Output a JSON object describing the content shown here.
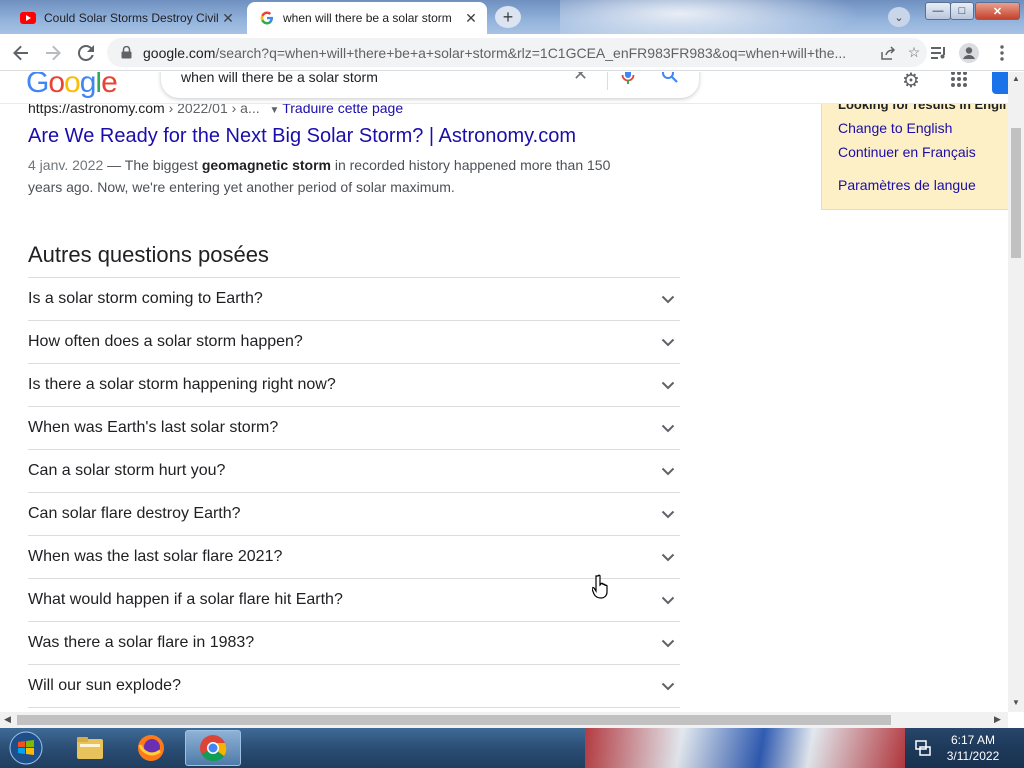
{
  "tabs": [
    {
      "title": "Could Solar Storms Destroy Civili",
      "active": false,
      "icon": "youtube-icon"
    },
    {
      "title": "when will there be a solar storm",
      "active": true,
      "icon": "google-icon"
    }
  ],
  "window_controls": {
    "minimize": "—",
    "maximize": "□",
    "close": "✕"
  },
  "omnibox": {
    "host": "google.com",
    "rest": "/search?q=when+will+there+be+a+solar+storm&rlz=1C1GCEA_enFR983FR983&oq=when+will+the..."
  },
  "search": {
    "logo": "Google",
    "query": "when will there be a solar storm"
  },
  "result": {
    "cite_url": "https://astronomy.com",
    "cite_path": " › 2022/01 › a...",
    "translate_label": "Traduire cette page",
    "title": "Are We Ready for the Next Big Solar Storm? | Astronomy.com",
    "date": "4 janv. 2022",
    "snippet_pre": " — The biggest ",
    "snippet_bold": "geomagnetic storm",
    "snippet_post": " in recorded history happened more than 150 years ago. Now, we're entering yet another period of solar maximum."
  },
  "paa": {
    "title": "Autres questions posées",
    "questions": [
      "Is a solar storm coming to Earth?",
      "How often does a solar storm happen?",
      "Is there a solar storm happening right now?",
      "When was Earth's last solar storm?",
      "Can a solar storm hurt you?",
      "Can solar flare destroy Earth?",
      "When was the last solar flare 2021?",
      "What would happen if a solar flare hit Earth?",
      "Was there a solar flare in 1983?",
      "Will our sun explode?"
    ]
  },
  "language_panel": {
    "heading": "Looking for results in Engli",
    "change_english": "Change to English",
    "continue_french": "Continuer en Français",
    "settings": "Paramètres de langue"
  },
  "taskbar": {
    "time": "6:17 AM",
    "date": "3/11/2022"
  },
  "colors": {
    "link": "#1a0dab",
    "google_blue": "#4285f4",
    "google_red": "#ea4335",
    "google_yellow": "#fbbc05",
    "google_green": "#34a853",
    "panel_bg": "#fdf0c6"
  }
}
